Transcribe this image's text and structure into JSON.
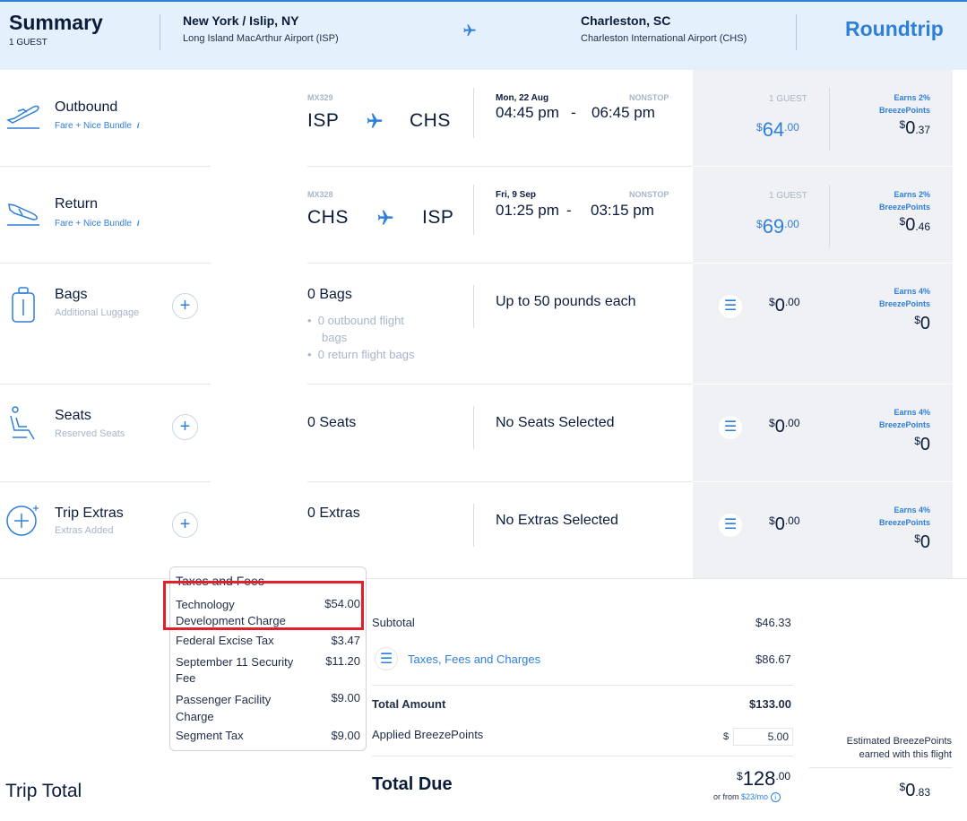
{
  "header": {
    "title": "Summary",
    "guests": "1 GUEST",
    "origin_city": "New York / Islip, NY",
    "origin_airport": "Long Island MacArthur Airport (ISP)",
    "dest_city": "Charleston, SC",
    "dest_airport": "Charleston International Airport (CHS)",
    "trip_type": "Roundtrip"
  },
  "outbound": {
    "label": "Outbound",
    "sub": "Fare + Nice Bundle",
    "info": "i",
    "flight_no": "MX329",
    "from": "ISP",
    "to": "CHS",
    "date": "Mon, 22 Aug",
    "nonstop": "NONSTOP",
    "dep": "04:45 pm",
    "dash": "-",
    "arr": "06:45 pm",
    "guests": "1 GUEST",
    "dollar": "$",
    "price_whole": "64",
    "price_cents": ".00",
    "earns": "Earns 2%",
    "bp": "BreezePoints",
    "pts_whole": "0",
    "pts_cents": ".37"
  },
  "return": {
    "label": "Return",
    "sub": "Fare + Nice Bundle",
    "info": "i",
    "flight_no": "MX328",
    "from": "CHS",
    "to": "ISP",
    "date": "Fri, 9 Sep",
    "nonstop": "NONSTOP",
    "dep": "01:25 pm",
    "dash": "-",
    "arr": "03:15 pm",
    "guests": "1 GUEST",
    "dollar": "$",
    "price_whole": "69",
    "price_cents": ".00",
    "earns": "Earns 2%",
    "bp": "BreezePoints",
    "pts_whole": "0",
    "pts_cents": ".46"
  },
  "bags": {
    "label": "Bags",
    "sub": "Additional Luggage",
    "count": "0 Bags",
    "bullet1_a": "0 outbound flight",
    "bullet1_b": "bags",
    "bullet2": "0 return flight bags",
    "desc": "Up to 50 pounds each",
    "dollar": "$",
    "amt_whole": "0",
    "amt_cents": ".00",
    "earns": "Earns 4%",
    "bp": "BreezePoints",
    "pts_whole": "0"
  },
  "seats": {
    "label": "Seats",
    "sub": "Reserved Seats",
    "count": "0 Seats",
    "desc": "No Seats Selected",
    "dollar": "$",
    "amt_whole": "0",
    "amt_cents": ".00",
    "earns": "Earns 4%",
    "bp": "BreezePoints",
    "pts_whole": "0"
  },
  "extras": {
    "label": "Trip Extras",
    "sub": "Extras Added",
    "count": "0 Extras",
    "desc": "No Extras Selected",
    "dollar": "$",
    "amt_whole": "0",
    "amt_cents": ".00",
    "earns": "Earns 4%",
    "bp": "BreezePoints",
    "pts_whole": "0"
  },
  "tooltip": {
    "title": "Taxes and Fees",
    "items": [
      {
        "name_a": "Technology",
        "name_b": "Development Charge",
        "amount": "$54.00"
      },
      {
        "name_a": "Federal Excise Tax",
        "name_b": "",
        "amount": "$3.47"
      },
      {
        "name_a": "September 11 Security",
        "name_b": "Fee",
        "amount": "$11.20"
      },
      {
        "name_a": "Passenger Facility",
        "name_b": "Charge",
        "amount": "$9.00"
      },
      {
        "name_a": "Segment Tax",
        "name_b": "",
        "amount": "$9.00"
      }
    ]
  },
  "summary": {
    "subtotal_label": "Subtotal",
    "subtotal": "$46.33",
    "taxes_label": "Taxes, Fees and Charges",
    "taxes": "$86.67",
    "total_label": "Total Amount",
    "total": "$133.00",
    "applied_label": "Applied BreezePoints",
    "applied_currency": "$",
    "applied_value": "5.00",
    "due_label": "Total Due",
    "due_dollar": "$",
    "due_whole": "128",
    "due_cents": ".00",
    "or_from": "or from",
    "monthly": "$23/mo",
    "info": "i",
    "trip_total": "Trip Total",
    "est_line1": "Estimated BreezePoints",
    "est_line2": "earned with this flight",
    "est_dollar": "$",
    "est_whole": "0",
    "est_cents": ".83"
  },
  "colors": {
    "accent": "#2f7fd8",
    "header_bg": "#e4f1fc",
    "highlight": "#e0202a"
  }
}
